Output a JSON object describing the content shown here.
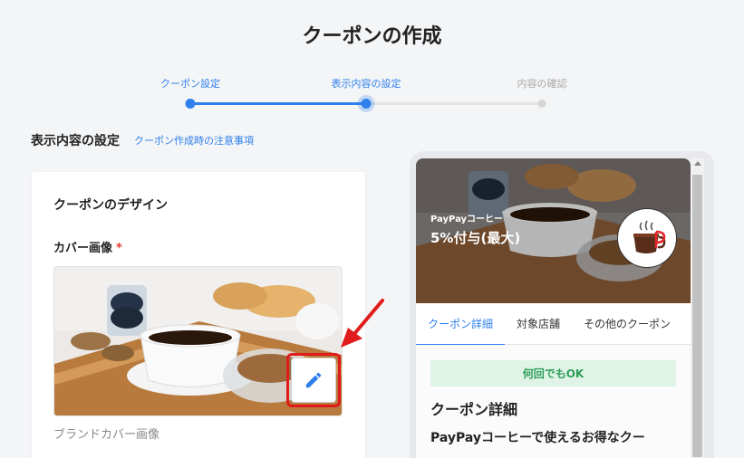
{
  "page": {
    "title": "クーポンの作成"
  },
  "stepper": {
    "steps": [
      {
        "label": "クーポン設定",
        "state": "done"
      },
      {
        "label": "表示内容の設定",
        "state": "current"
      },
      {
        "label": "内容の確認",
        "state": "pending"
      }
    ],
    "colors": {
      "active": "#2f80ed",
      "inactive": "#c8c8c8"
    }
  },
  "section": {
    "title": "表示内容の設定",
    "notes_link": "クーポン作成時の注意事項"
  },
  "design_card": {
    "title": "クーポンのデザイン",
    "cover_label": "カバー画像",
    "required_mark": "*",
    "image_caption": "ブランドカバー画像",
    "edit_icon": "pencil-icon"
  },
  "preview": {
    "brand": "PayPayコーヒー",
    "offer": "5%付与(最大)",
    "tabs": [
      "クーポン詳細",
      "対象店舗",
      "その他のクーポン"
    ],
    "active_tab": 0,
    "badge": "何回でもOK",
    "detail_title": "クーポン詳細",
    "detail_text": "PayPayコーヒーで使えるお得なクー"
  }
}
